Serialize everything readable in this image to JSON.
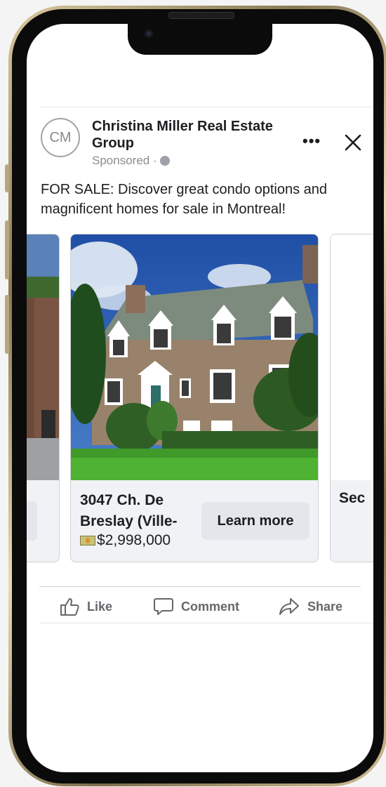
{
  "post": {
    "page_initials": "CM",
    "page_name": "Christina Miller Real Estate Group",
    "sponsored_label": "Sponsored ·",
    "text": "FOR SALE: Discover great condo options and magnificent homes for sale in Montreal!"
  },
  "carousel": {
    "cards": [
      {
        "title": "3047 Ch. De Breslay (Ville-",
        "price": "$2,998,000",
        "cta": "Learn more"
      },
      {
        "title": "Sec"
      }
    ]
  },
  "actions": {
    "like": "Like",
    "comment": "Comment",
    "share": "Share"
  },
  "icons": [
    "more-options-icon",
    "close-icon",
    "globe-icon",
    "money-icon",
    "like-icon",
    "comment-icon",
    "share-icon"
  ]
}
